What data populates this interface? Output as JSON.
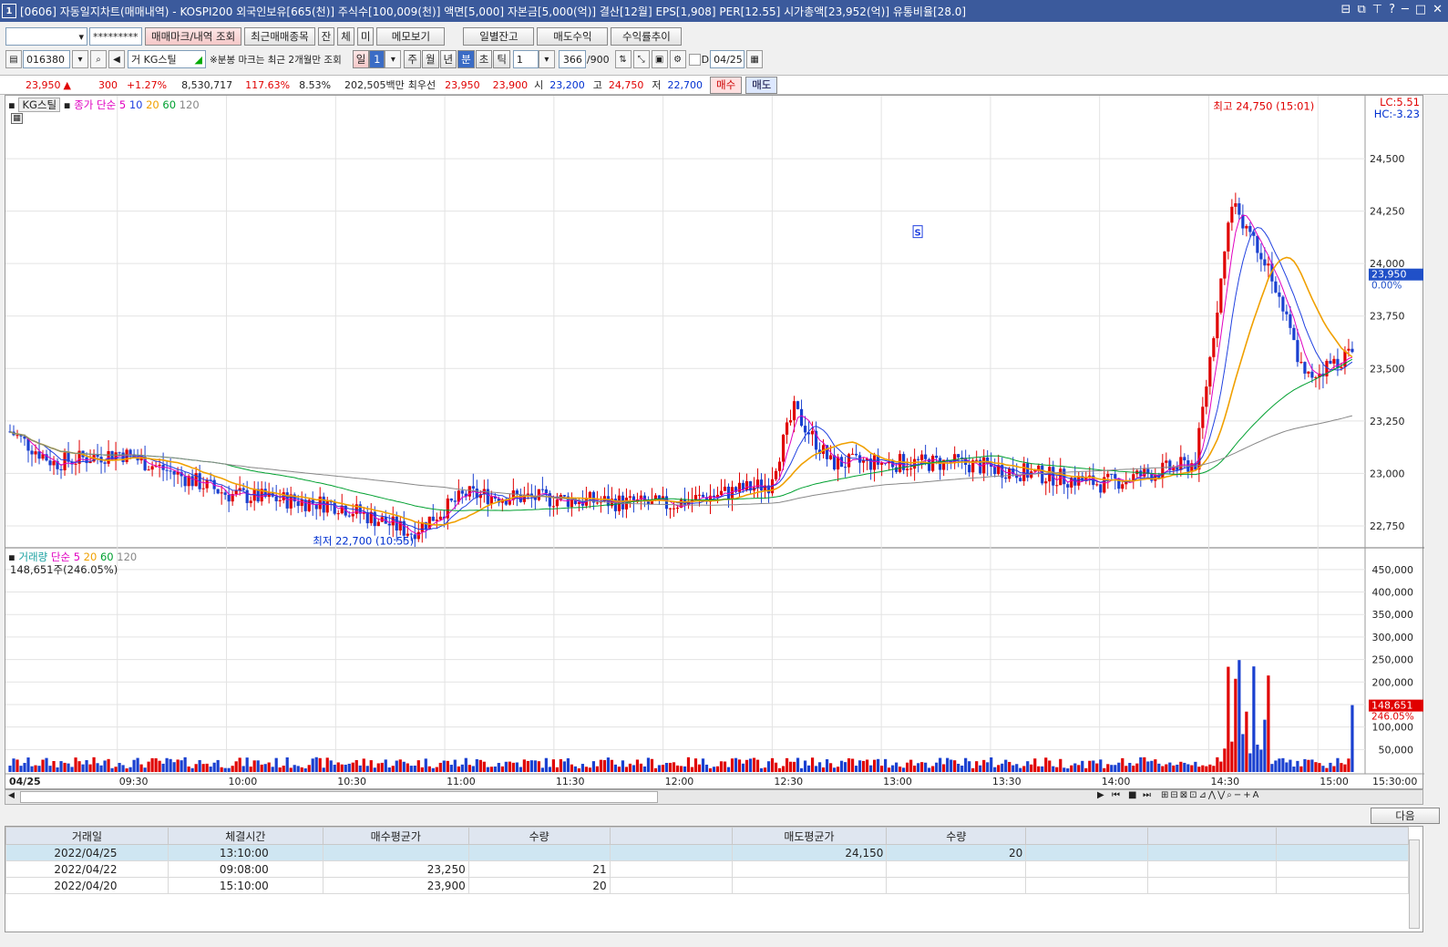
{
  "window": {
    "num": "1",
    "title": "[0606] 자동일지차트(매매내역) - KOSPI200 외국인보유[665(천)] 주식수[100,009(천)] 액면[5,000] 자본금[5,000(억)] 결산[12월] EPS[1,908] PER[12.55] 시가총액[23,952(억)] 유통비율[28.0]",
    "controls": [
      "⊟",
      "⧉",
      "⊤",
      "?",
      "─",
      "□",
      "✕"
    ]
  },
  "toolbar1": {
    "account": "",
    "password": "*********",
    "buttons": [
      "매매마크/내역 조회",
      "최근매매종목",
      "잔",
      "체",
      "미",
      "메모보기",
      "일별잔고",
      "매도수익",
      "수익률추이"
    ]
  },
  "toolbar2": {
    "code": "016380",
    "stock_prefix": "거",
    "stock_name": "KG스틸",
    "notice": "※분봉 마크는 최근 2개월만 조회",
    "period": "일",
    "period_num": "1",
    "periods": [
      "주",
      "월",
      "년",
      "분",
      "초",
      "틱"
    ],
    "interval": "1",
    "count": "366",
    "count_max": "/900",
    "date_prefix": "D",
    "date": "04/25"
  },
  "quote": {
    "price": "23,950",
    "change": "300",
    "rate": "+1.27%",
    "volume": "8,530,717",
    "vol_ratio": "117.63%",
    "turnover": "8.53%",
    "amount": "202,505백만",
    "best_label": "최우선",
    "best_ask": "23,950",
    "best_bid": "23,900",
    "open_label": "시",
    "open": "23,200",
    "high_label": "고",
    "high": "24,750",
    "low_label": "저",
    "low": "22,700",
    "buy": "매수",
    "sell": "매도"
  },
  "chart": {
    "legend_name": "KG스틸",
    "legend_price": "종가 단순",
    "ma_periods": [
      "5",
      "10",
      "20",
      "60",
      "120"
    ],
    "max_label": "최고 24,750 (15:01)",
    "min_label": "최저 22,700 (10:55)",
    "lc": "LC:5.51",
    "hc": "HC:-3.23",
    "price_ticks": [
      "24,500",
      "24,250",
      "24,000",
      "23,750",
      "23,500",
      "23,250",
      "23,000",
      "22,750"
    ],
    "current_price": "23,950",
    "current_pct": "0.00%",
    "vol_legend_name": "거래량",
    "vol_legend_price": "단순",
    "vol_ma_periods": [
      "5",
      "20",
      "60",
      "120"
    ],
    "vol_info": "148,651주(246.05%)",
    "vol_ticks": [
      "450,000",
      "400,000",
      "350,000",
      "300,000",
      "250,000",
      "200,000",
      "150,000",
      "100,000",
      "50,000"
    ],
    "current_vol": "148,651",
    "current_vol_pct": "246.05%",
    "time_ticks": [
      "04/25",
      "09:30",
      "10:00",
      "10:30",
      "11:00",
      "11:30",
      "12:00",
      "12:30",
      "13:00",
      "13:30",
      "14:00",
      "14:30",
      "15:00",
      "15:30:00"
    ],
    "sell_mark": "S",
    "colors": {
      "up": "#e00000",
      "down": "#1a40d0",
      "ma5": "#e000c0",
      "ma10": "#2040e0",
      "ma20": "#f0a000",
      "ma60": "#00a030",
      "ma120": "#888888"
    }
  },
  "chart_data": {
    "type": "candlestick",
    "title": "",
    "x_start": "09:00",
    "x_end": "15:30",
    "ylim": [
      22650,
      24800
    ],
    "open": 23200,
    "high": 24750,
    "low": 22700,
    "close": 23950,
    "high_time": "15:01",
    "low_time": "10:55",
    "volume_ylim": [
      0,
      480000
    ],
    "last_volume": 148651
  },
  "table": {
    "next": "다음",
    "headers": [
      "거래일",
      "체결시간",
      "매수평균가",
      "수량",
      "",
      "매도평균가",
      "수량",
      "",
      "",
      ""
    ],
    "rows": [
      [
        "2022/04/25",
        "13:10:00",
        "",
        "",
        "",
        "24,150",
        "20",
        "",
        "",
        ""
      ],
      [
        "2022/04/22",
        "09:08:00",
        "23,250",
        "21",
        "",
        "",
        "",
        "",
        "",
        ""
      ],
      [
        "2022/04/20",
        "15:10:00",
        "23,900",
        "20",
        "",
        "",
        "",
        "",
        "",
        ""
      ]
    ]
  }
}
